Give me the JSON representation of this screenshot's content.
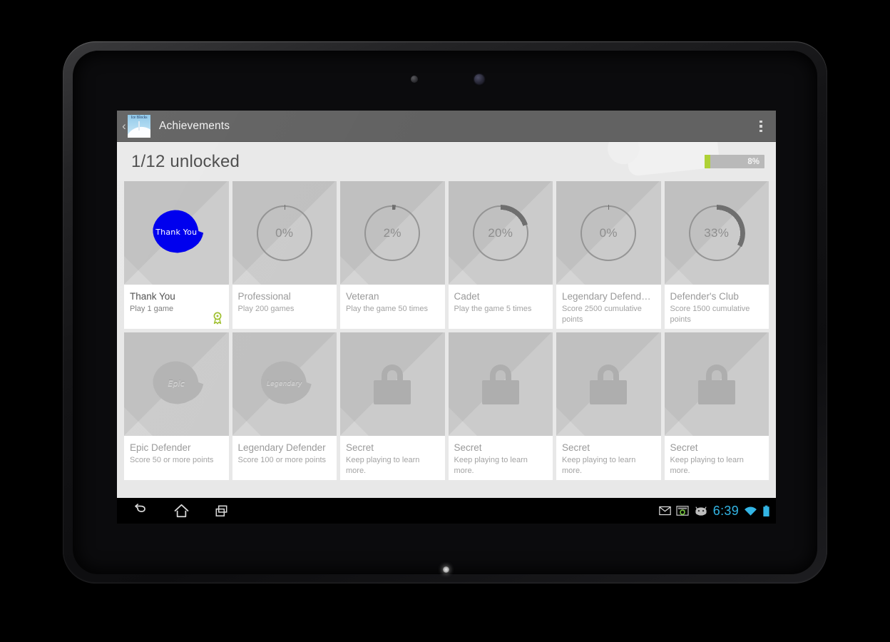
{
  "device": {
    "camera_icon": "camera-dot",
    "sensor_icon": "sensor-dot",
    "notification_led": "home-led"
  },
  "action_bar": {
    "up_caret": "‹",
    "app_icon_name": "app-logo",
    "app_icon_glyph": "Ice Blocks",
    "title": "Achievements",
    "overflow_icon": "overflow-menu-icon"
  },
  "header": {
    "unlocked_text": "1/12 unlocked",
    "progress_percent_label": "8%",
    "progress_percent_value": 8,
    "progress_fill_color": "#aed136",
    "progress_track_color": "#b9b9b9"
  },
  "achievements": [
    {
      "title": "Thank You",
      "description": "Play 1 game",
      "state": "unlocked",
      "art": "badge",
      "badge_text": "Thank You",
      "badge_color": "#0000ee",
      "award_icon": "award-ribbon-icon",
      "progress": null
    },
    {
      "title": "Professional",
      "description": "Play 200 games",
      "state": "locked",
      "art": "ring",
      "progress": 0,
      "progress_label": "0%"
    },
    {
      "title": "Veteran",
      "description": "Play the game 50 times",
      "state": "locked",
      "art": "ring",
      "progress": 2,
      "progress_label": "2%"
    },
    {
      "title": "Cadet",
      "description": "Play the game 5 times",
      "state": "locked",
      "art": "ring",
      "progress": 20,
      "progress_label": "20%"
    },
    {
      "title": "Legendary Defende…",
      "description": "Score 2500 cumulative points",
      "state": "locked",
      "art": "ring",
      "progress": 0,
      "progress_label": "0%"
    },
    {
      "title": "Defender's Club",
      "description": "Score 1500 cumulative points",
      "state": "locked",
      "art": "ring",
      "progress": 33,
      "progress_label": "33%"
    },
    {
      "title": "Epic Defender",
      "description": "Score 50 or more points",
      "state": "locked",
      "art": "badge",
      "badge_text": "Epic",
      "badge_color": "#b4b4b4",
      "progress": null
    },
    {
      "title": "Legendary Defender",
      "description": "Score 100 or more points",
      "state": "locked",
      "art": "badge",
      "badge_text": "Legendary",
      "badge_color": "#b4b4b4",
      "progress": null
    },
    {
      "title": "Secret",
      "description": "Keep playing to learn more.",
      "state": "secret",
      "art": "lock",
      "progress": null
    },
    {
      "title": "Secret",
      "description": "Keep playing to learn more.",
      "state": "secret",
      "art": "lock",
      "progress": null
    },
    {
      "title": "Secret",
      "description": "Keep playing to learn more.",
      "state": "secret",
      "art": "lock",
      "progress": null
    },
    {
      "title": "Secret",
      "description": "Keep playing to learn more.",
      "state": "secret",
      "art": "lock",
      "progress": null
    }
  ],
  "nav_bar": {
    "back_icon": "back-arrow-icon",
    "home_icon": "home-icon",
    "recents_icon": "recent-apps-icon"
  },
  "status_bar": {
    "icons": [
      "gmail-icon",
      "screenshot-icon",
      "android-head-icon"
    ],
    "clock": "6:39",
    "clock_color": "#33b5e5",
    "wifi_icon": "wifi-icon",
    "battery_icon": "battery-full-icon"
  }
}
